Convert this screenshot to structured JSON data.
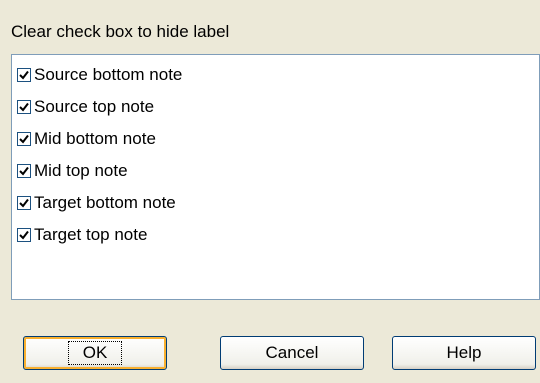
{
  "instruction": "Clear check box to hide label",
  "label_items": [
    {
      "label": "Source bottom note",
      "checked": true
    },
    {
      "label": "Source top note",
      "checked": true
    },
    {
      "label": "Mid bottom note",
      "checked": true
    },
    {
      "label": "Mid top note",
      "checked": true
    },
    {
      "label": "Target bottom note",
      "checked": true
    },
    {
      "label": "Target top note",
      "checked": true
    }
  ],
  "buttons": {
    "ok": "OK",
    "cancel": "Cancel",
    "help": "Help"
  },
  "colors": {
    "dialog_background": "#ECE9D8",
    "list_border": "#7F9DB9",
    "checkbox_border": "#1C5180",
    "button_border": "#003C74",
    "default_button_highlight": "#F8B030"
  }
}
